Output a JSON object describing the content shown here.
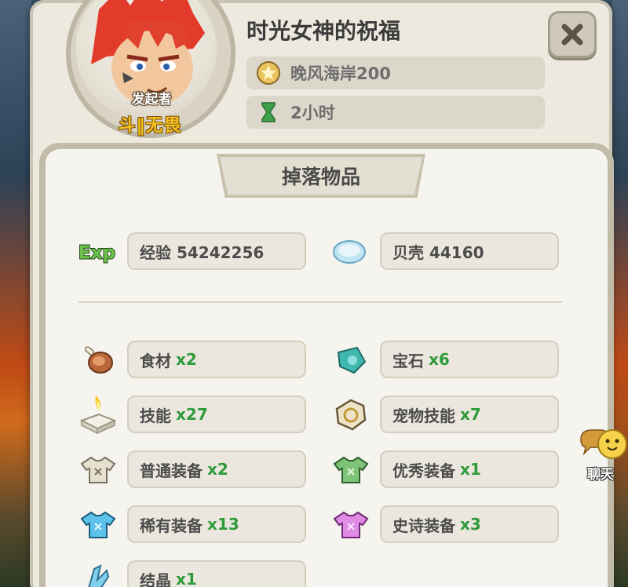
{
  "header": {
    "title": "时光女神的祝福",
    "starter_label": "发起者",
    "guild_label": "斗‖无畏",
    "location": "晚风海岸200",
    "duration": "2小时"
  },
  "drops": {
    "tab_label": "掉落物品",
    "currency": [
      {
        "icon": "exp-icon",
        "label": "经验 54242256"
      },
      {
        "icon": "shell-icon",
        "label": "贝壳 44160"
      }
    ],
    "items": [
      {
        "icon": "meat-icon",
        "name": "食材",
        "qty": "x2"
      },
      {
        "icon": "gem-icon",
        "name": "宝石",
        "qty": "x6"
      },
      {
        "icon": "skill-book-icon",
        "name": "技能",
        "qty": "x27"
      },
      {
        "icon": "pet-skill-icon",
        "name": "宠物技能",
        "qty": "x7"
      },
      {
        "icon": "common-gear-icon",
        "name": "普通装备",
        "qty": "x2"
      },
      {
        "icon": "good-gear-icon",
        "name": "优秀装备",
        "qty": "x1"
      },
      {
        "icon": "rare-gear-icon",
        "name": "稀有装备",
        "qty": "x13"
      },
      {
        "icon": "epic-gear-icon",
        "name": "史诗装备",
        "qty": "x3"
      },
      {
        "icon": "crystal-icon",
        "name": "结晶",
        "qty": "x1"
      }
    ]
  },
  "chat": {
    "label": "聊天"
  },
  "colors": {
    "quantity": "#2f9a3a",
    "guild": "#f4c21c",
    "common_gear": "#d8d2c0",
    "good_gear": "#7fc37a",
    "rare_gear": "#5cc2ec",
    "epic_gear": "#e08be6"
  }
}
